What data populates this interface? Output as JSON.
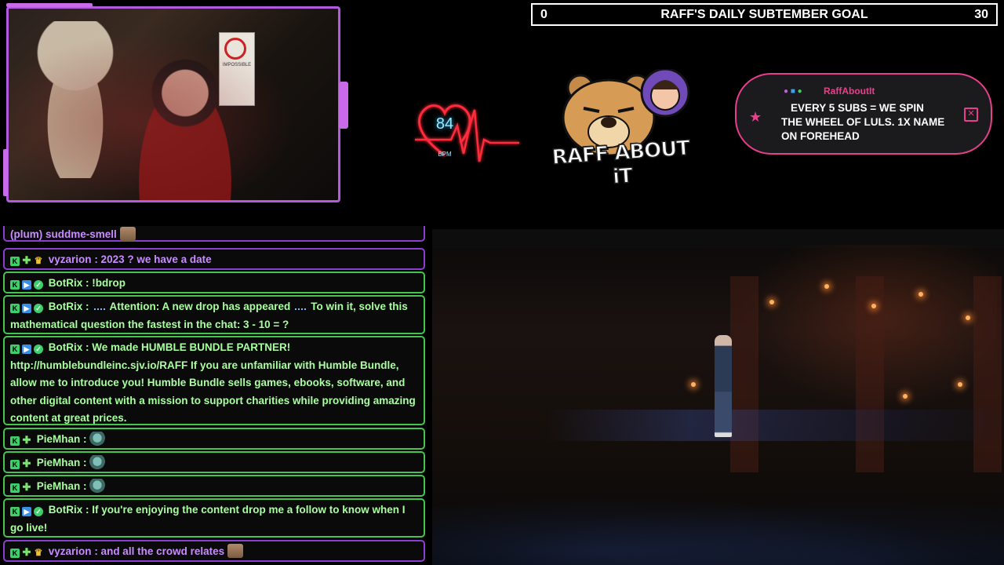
{
  "goal": {
    "start": "0",
    "title": "RAFF'S DAILY SUBTEMBER GOAL",
    "end": "30",
    "current": 0
  },
  "heart_monitor": {
    "bpm": "84",
    "label": "BPM",
    "color": "#ff2b3a"
  },
  "logo": {
    "text": "RAFF ABOUT iT"
  },
  "pinned": {
    "username": "RaffAboutIt",
    "text_line1": "EVERY 5 SUBS = WE SPIN",
    "text_rest": "THE WHEEL OF LULS. 1X NAME ON FOREHEAD",
    "accent": "#e83e8c"
  },
  "webcam": {
    "sign_text": "IMPOSSIBLE"
  },
  "chat": {
    "partial_top": "(plum) suddme-smell",
    "messages": [
      {
        "user": "vyzarion",
        "text": ": 2023 ? we have a date"
      },
      {
        "user": "BotRix",
        "text": ": !bdrop"
      },
      {
        "user": "BotRix",
        "text_a": ":",
        "text_b": "Attention: A new drop has appeared",
        "text_c": "To win it, solve this mathematical question the fastest in the chat: 3 - 10 = ?"
      },
      {
        "user": "BotRix",
        "text": ": We made HUMBLE BUNDLE PARTNER! http://humblebundleinc.sjv.io/RAFF If you are unfamiliar with Humble Bundle, allow me to introduce you! Humble Bundle sells games, ebooks, software, and other digital content with a mission to support charities while providing amazing content at great prices."
      },
      {
        "user": "PieMhan",
        "text": ":"
      },
      {
        "user": "PieMhan",
        "text": ":"
      },
      {
        "user": "PieMhan",
        "text": ":"
      },
      {
        "user": "BotRix",
        "text": ": If you're enjoying the content drop me a follow to know when I go live!"
      },
      {
        "user": "vyzarion",
        "text": ": and all the crowd relates"
      }
    ]
  },
  "colors": {
    "chat_purple": "#8a3fd1",
    "chat_green": "#43c64b",
    "webcam_border": "#b35be0"
  }
}
